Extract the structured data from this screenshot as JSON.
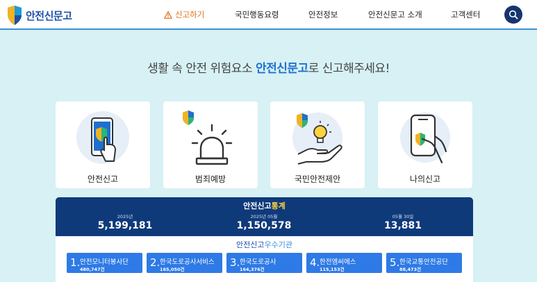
{
  "header": {
    "logo_text": "안전신문고",
    "nav": [
      {
        "label": "신고하기"
      },
      {
        "label": "국민행동요령"
      },
      {
        "label": "안전정보"
      },
      {
        "label": "안전신문고 소개"
      },
      {
        "label": "고객센터"
      }
    ]
  },
  "hero": {
    "prefix": "생활 속 안전 위험요소 ",
    "accent": "안전신문고",
    "suffix": "로 신고해주세요!"
  },
  "cards": [
    {
      "label": "안전신고",
      "icon": "phone-touch-shield-icon"
    },
    {
      "label": "범죄예방",
      "icon": "siren-shield-icon"
    },
    {
      "label": "국민안전제안",
      "icon": "hand-lightbulb-shield-icon"
    },
    {
      "label": "나의신고",
      "icon": "phone-hand-shield-icon"
    }
  ],
  "stats": {
    "title_prefix": "안전신고",
    "title_highlight": "통계",
    "items": [
      {
        "caption": "2025년",
        "value": "5,199,181"
      },
      {
        "caption": "2025년 05월",
        "value": "1,150,578"
      },
      {
        "caption": "05월 30일",
        "value": "13,881"
      }
    ]
  },
  "ranks": {
    "title_prefix": "안전신고",
    "title_highlight": "우수기관",
    "items": [
      {
        "num": "1.",
        "name": "안전모니터봉사단",
        "count": "480,747건"
      },
      {
        "num": "2.",
        "name": "한국도로공사서비스",
        "count": "165,050건"
      },
      {
        "num": "3.",
        "name": "한국도로공사",
        "count": "164,376건"
      },
      {
        "num": "4.",
        "name": "한전엠씨에스",
        "count": "115,153건"
      },
      {
        "num": "5.",
        "name": "한국교통안전공단",
        "count": "88,473건"
      }
    ]
  },
  "colors": {
    "brand_navy": "#0f3a7a",
    "accent_blue": "#1f6fd1",
    "report_orange": "#e0701b",
    "background": "#d7f1f4"
  }
}
